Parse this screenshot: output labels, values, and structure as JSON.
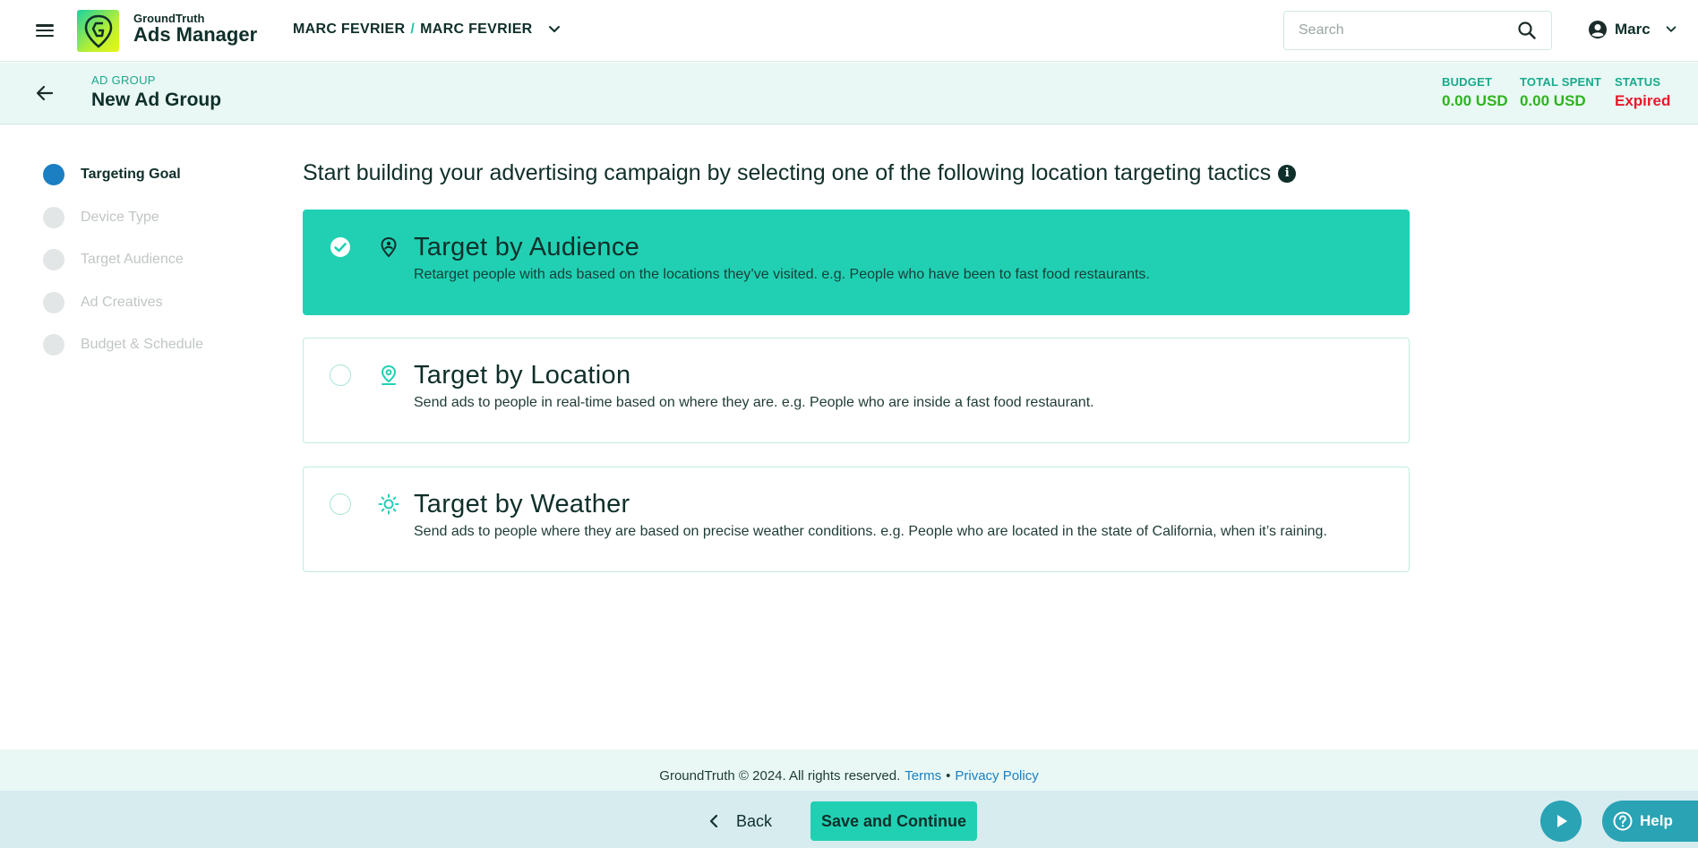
{
  "header": {
    "menu_icon": "hamburger-menu-icon",
    "brand_small": "GroundTruth",
    "brand_big": "Ads Manager",
    "account_left": "MARC FEVRIER",
    "account_separator": "/",
    "account_right": "MARC FEVRIER",
    "search_placeholder": "Search",
    "user_name": "Marc"
  },
  "subheader": {
    "label": "AD GROUP",
    "name": "New Ad Group",
    "stats": [
      {
        "label": "BUDGET",
        "value": "0.00 USD",
        "color": "#2fb31e"
      },
      {
        "label": "TOTAL SPENT",
        "value": "0.00 USD",
        "color": "#2fb31e"
      },
      {
        "label": "STATUS",
        "value": "Expired",
        "color": "#e8192c"
      }
    ]
  },
  "steps": [
    {
      "label": "Targeting Goal",
      "active": true
    },
    {
      "label": "Device Type",
      "active": false
    },
    {
      "label": "Target Audience",
      "active": false
    },
    {
      "label": "Ad Creatives",
      "active": false
    },
    {
      "label": "Budget & Schedule",
      "active": false
    }
  ],
  "main": {
    "heading": "Start building your advertising campaign by selecting one of the following location targeting tactics",
    "info_icon": "i",
    "options": [
      {
        "title": "Target by Audience",
        "description": "Retarget people with ads based on the locations they’ve visited. e.g. People who have been to fast food restaurants.",
        "icon": "audience-pin-icon",
        "selected": true
      },
      {
        "title": "Target by Location",
        "description": "Send ads to people in real-time based on where they are. e.g. People who are inside a fast food restaurant.",
        "icon": "location-pin-icon",
        "selected": false
      },
      {
        "title": "Target by Weather",
        "description": "Send ads to people where they are based on precise weather conditions. e.g. People who are located in the state of California, when it’s raining.",
        "icon": "sun-icon",
        "selected": false
      }
    ]
  },
  "footer": {
    "copyright": "GroundTruth © 2024. All rights reserved.",
    "terms": "Terms",
    "bullet": "•",
    "privacy": "Privacy Policy",
    "back_label": "Back",
    "save_label": "Save and Continue",
    "help_label": "Help"
  },
  "colors": {
    "accent": "#21d0b3",
    "active_step": "#1b7fc2",
    "link": "#1b7fc2"
  }
}
